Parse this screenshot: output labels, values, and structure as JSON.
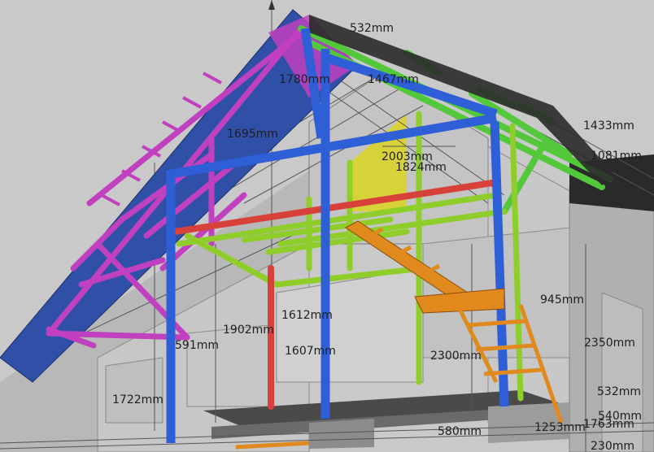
{
  "model": {
    "colors": {
      "background": "#c9c9c9",
      "roof_panel": "#3050a8",
      "truss": "#c040c0",
      "frame_blue": "#2f5fd6",
      "frame_green": "#52c83a",
      "beam_red": "#d8403a",
      "lime": "#8fce2a",
      "stair_orange": "#e08a1e",
      "wall_grey": "#bdbdbd",
      "yellow_panel": "#d8d23a",
      "dark_panel": "#2a2a2a"
    },
    "dimensions": [
      {
        "id": "d532-top",
        "text": "532mm"
      },
      {
        "id": "d1780",
        "text": "1780mm"
      },
      {
        "id": "d1467",
        "text": "1467mm"
      },
      {
        "id": "d1695",
        "text": "1695mm"
      },
      {
        "id": "d2003",
        "text": "2003mm"
      },
      {
        "id": "d1824",
        "text": "1824mm"
      },
      {
        "id": "d1433",
        "text": "1433mm"
      },
      {
        "id": "d1081",
        "text": "1081mm"
      },
      {
        "id": "d1612",
        "text": "1612mm"
      },
      {
        "id": "d1902",
        "text": "1902mm"
      },
      {
        "id": "d591",
        "text": "591mm"
      },
      {
        "id": "d1607",
        "text": "1607mm"
      },
      {
        "id": "d945",
        "text": "945mm"
      },
      {
        "id": "d2350",
        "text": "2350mm"
      },
      {
        "id": "d2300",
        "text": "2300mm"
      },
      {
        "id": "d1722",
        "text": "1722mm"
      },
      {
        "id": "d580",
        "text": "580mm"
      },
      {
        "id": "d532-low",
        "text": "532mm"
      },
      {
        "id": "d540",
        "text": "540mm"
      },
      {
        "id": "d1763",
        "text": "1763mm"
      },
      {
        "id": "d1253",
        "text": "1253mm"
      },
      {
        "id": "d230",
        "text": "230mm"
      }
    ]
  }
}
